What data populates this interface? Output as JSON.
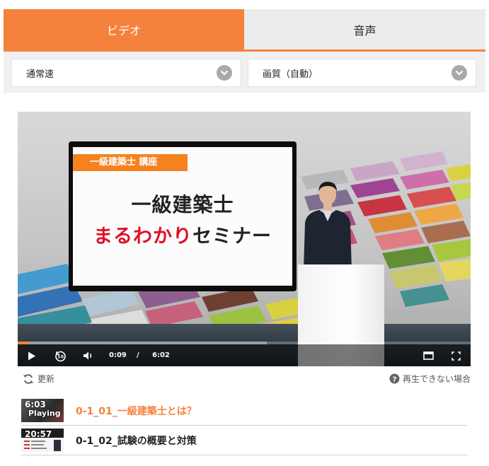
{
  "tabs": {
    "video_label": "ビデオ",
    "audio_label": "音声",
    "active": "video"
  },
  "selects": {
    "speed_value": "通常速",
    "quality_value": "画質（自動）"
  },
  "video_content": {
    "banner_text": "一級建築士 講座",
    "title_line1": "一級建築士",
    "title_line2_red": "まるわかり",
    "title_line2_black": "セミナー"
  },
  "player": {
    "current_time": "0:09",
    "separator": "/",
    "duration": "6:02",
    "progress_fraction": 0.025,
    "buffered_fraction": 0.55
  },
  "links": {
    "refresh_label": "更新",
    "help_label": "再生できない場合"
  },
  "playlist": [
    {
      "duration": "6:03",
      "status": "Playing",
      "title": "0-1_01_一級建築士とは？",
      "active": true
    },
    {
      "duration": "20:57",
      "status": "",
      "title": "0-1_02_試験の概要と対策",
      "active": false
    }
  ],
  "colors": {
    "accent": "#f5823c",
    "title_red": "#e0102a"
  }
}
